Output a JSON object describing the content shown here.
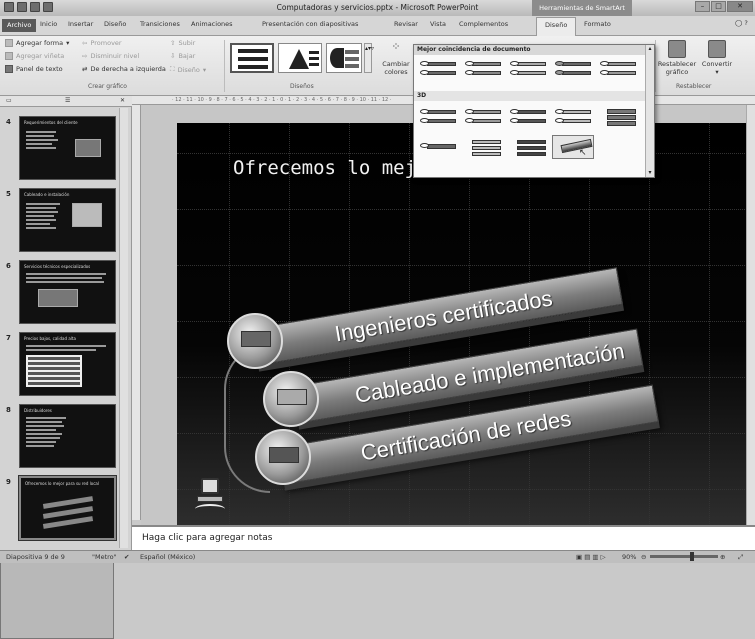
{
  "window_title": "Computadoras y servicios.pptx - Microsoft PowerPoint",
  "context_header": "Herramientas de SmartArt",
  "tabs": [
    "Archivo",
    "Inicio",
    "Insertar",
    "Diseño",
    "Transiciones",
    "Animaciones",
    "Presentación con diapositivas",
    "Revisar",
    "Vista",
    "Complementos",
    "Diseño",
    "Formato"
  ],
  "ribbon": {
    "add_shape": "Agregar forma",
    "add_bullet": "Agregar viñeta",
    "text_pane": "Panel de texto",
    "promote": "Promover",
    "demote": "Disminuir nivel",
    "rtl": "De derecha a izquierda",
    "move_up": "Subir",
    "move_down": "Bajar",
    "layout": "Diseño",
    "group_create": "Crear gráfico",
    "group_layouts": "Diseños",
    "change_colors_1": "Cambiar",
    "change_colors_2": "colores",
    "reset_graphic_1": "Restablecer",
    "reset_graphic_2": "gráfico",
    "convert": "Convertir",
    "group_reset": "Restablecer"
  },
  "gallery": {
    "section_best": "Mejor coincidencia de documento",
    "section_3d": "3D"
  },
  "slides": [
    {
      "num": "4",
      "title": "Requerimientos del cliente"
    },
    {
      "num": "5",
      "title": "Cableado e instalación"
    },
    {
      "num": "6",
      "title": "Servicios técnicos especializados"
    },
    {
      "num": "7",
      "title": "Precios bajos, calidad alta"
    },
    {
      "num": "8",
      "title": "Distribuidores"
    },
    {
      "num": "9",
      "title": "Ofrecemos lo mejor para su red local"
    }
  ],
  "slide": {
    "title": "Ofrecemos lo mejor para su red local",
    "items": [
      "Ingenieros certificados",
      "Cableado e implementación",
      "Certificación de redes"
    ]
  },
  "notes_placeholder": "Haga clic para agregar notas",
  "status": {
    "slide_count": "Diapositiva 9 de 9",
    "theme": "\"Metro\"",
    "language": "Español (México)",
    "zoom": "90%"
  }
}
